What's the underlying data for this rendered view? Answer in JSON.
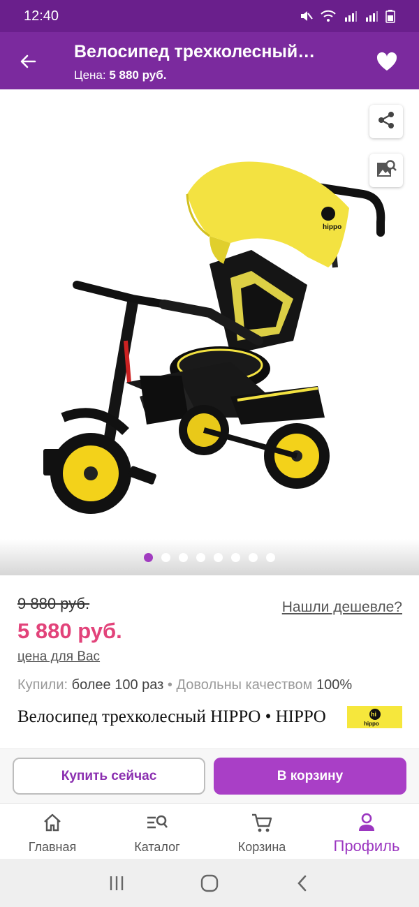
{
  "status_bar": {
    "time": "12:40",
    "icons": [
      "mute-icon",
      "wifi-icon",
      "signal-r-icon",
      "signal-r-icon",
      "battery-icon"
    ]
  },
  "header": {
    "title": "Велосипед трехколесный…",
    "price_label": "Цена:",
    "price_value": "5 880 руб.",
    "back_icon": "arrow-left-icon",
    "favorite_icon": "heart-icon",
    "background_color": "#7b2a9e"
  },
  "gallery": {
    "image_alt": "Велосипед трехколесный HIPPO",
    "brand_on_canopy": "hi hippo",
    "share_icon": "share-icon",
    "image_search_icon": "image-search-icon",
    "dots_count": 8,
    "active_dot": 0
  },
  "product": {
    "old_price": "9 880 руб.",
    "cheaper_link": "Нашли дешевле?",
    "new_price": "5 880 руб.",
    "for_you_label": "цена для Вас",
    "bought_label": "Купили:",
    "bought_value": "более 100 раз",
    "separator": "•",
    "quality_label": "Довольны качеством",
    "quality_value": "100%",
    "name": "Велосипед трехколесный HIPPO • HIPPO",
    "brand_logo_text": "hi hippo",
    "accent_price_color": "#e2437a"
  },
  "actions": {
    "buy_now": "Купить сейчас",
    "add_to_cart": "В корзину",
    "cart_button_color": "#a93fc6"
  },
  "bottom_nav": {
    "items": [
      {
        "label": "Главная",
        "icon": "home-icon",
        "active": false
      },
      {
        "label": "Каталог",
        "icon": "catalog-search-icon",
        "active": false
      },
      {
        "label": "Корзина",
        "icon": "cart-icon",
        "active": false
      },
      {
        "label": "Профиль",
        "icon": "profile-icon",
        "active": true
      }
    ],
    "active_color": "#9b36c0"
  },
  "system_nav": {
    "icons": [
      "recent-apps-icon",
      "home-circle-icon",
      "back-chevron-icon"
    ]
  }
}
